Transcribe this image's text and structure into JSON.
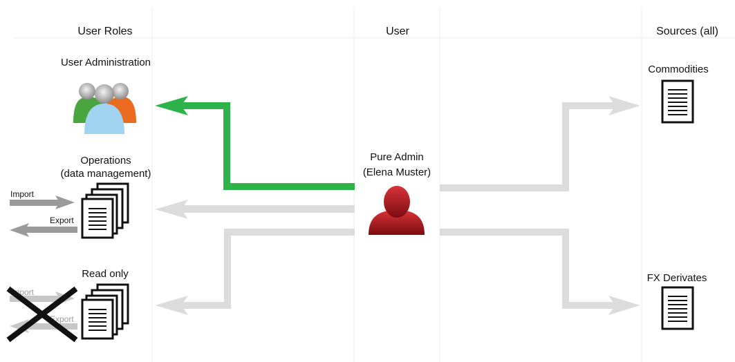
{
  "columns": {
    "roles_header": "User Roles",
    "user_header": "User",
    "sources_header": "Sources (all)"
  },
  "roles": {
    "admin": "User Administration",
    "operations_line1": "Operations",
    "operations_line2": "(data management)",
    "readonly": "Read only",
    "import_label": "Import",
    "export_label": "Export",
    "ro_import_label": "Import",
    "ro_export_label": "Export"
  },
  "user": {
    "name_line1": "Pure Admin",
    "name_line2": "(Elena Muster)"
  },
  "sources": {
    "commodities": "Commodities",
    "fx": "FX Derivates"
  },
  "colors": {
    "active_connection": "#2db34a",
    "inactive_connection": "#dcdcdc",
    "io_arrow": "#9a9a9a",
    "user_icon": "#a8141a",
    "cross": "#111111"
  }
}
